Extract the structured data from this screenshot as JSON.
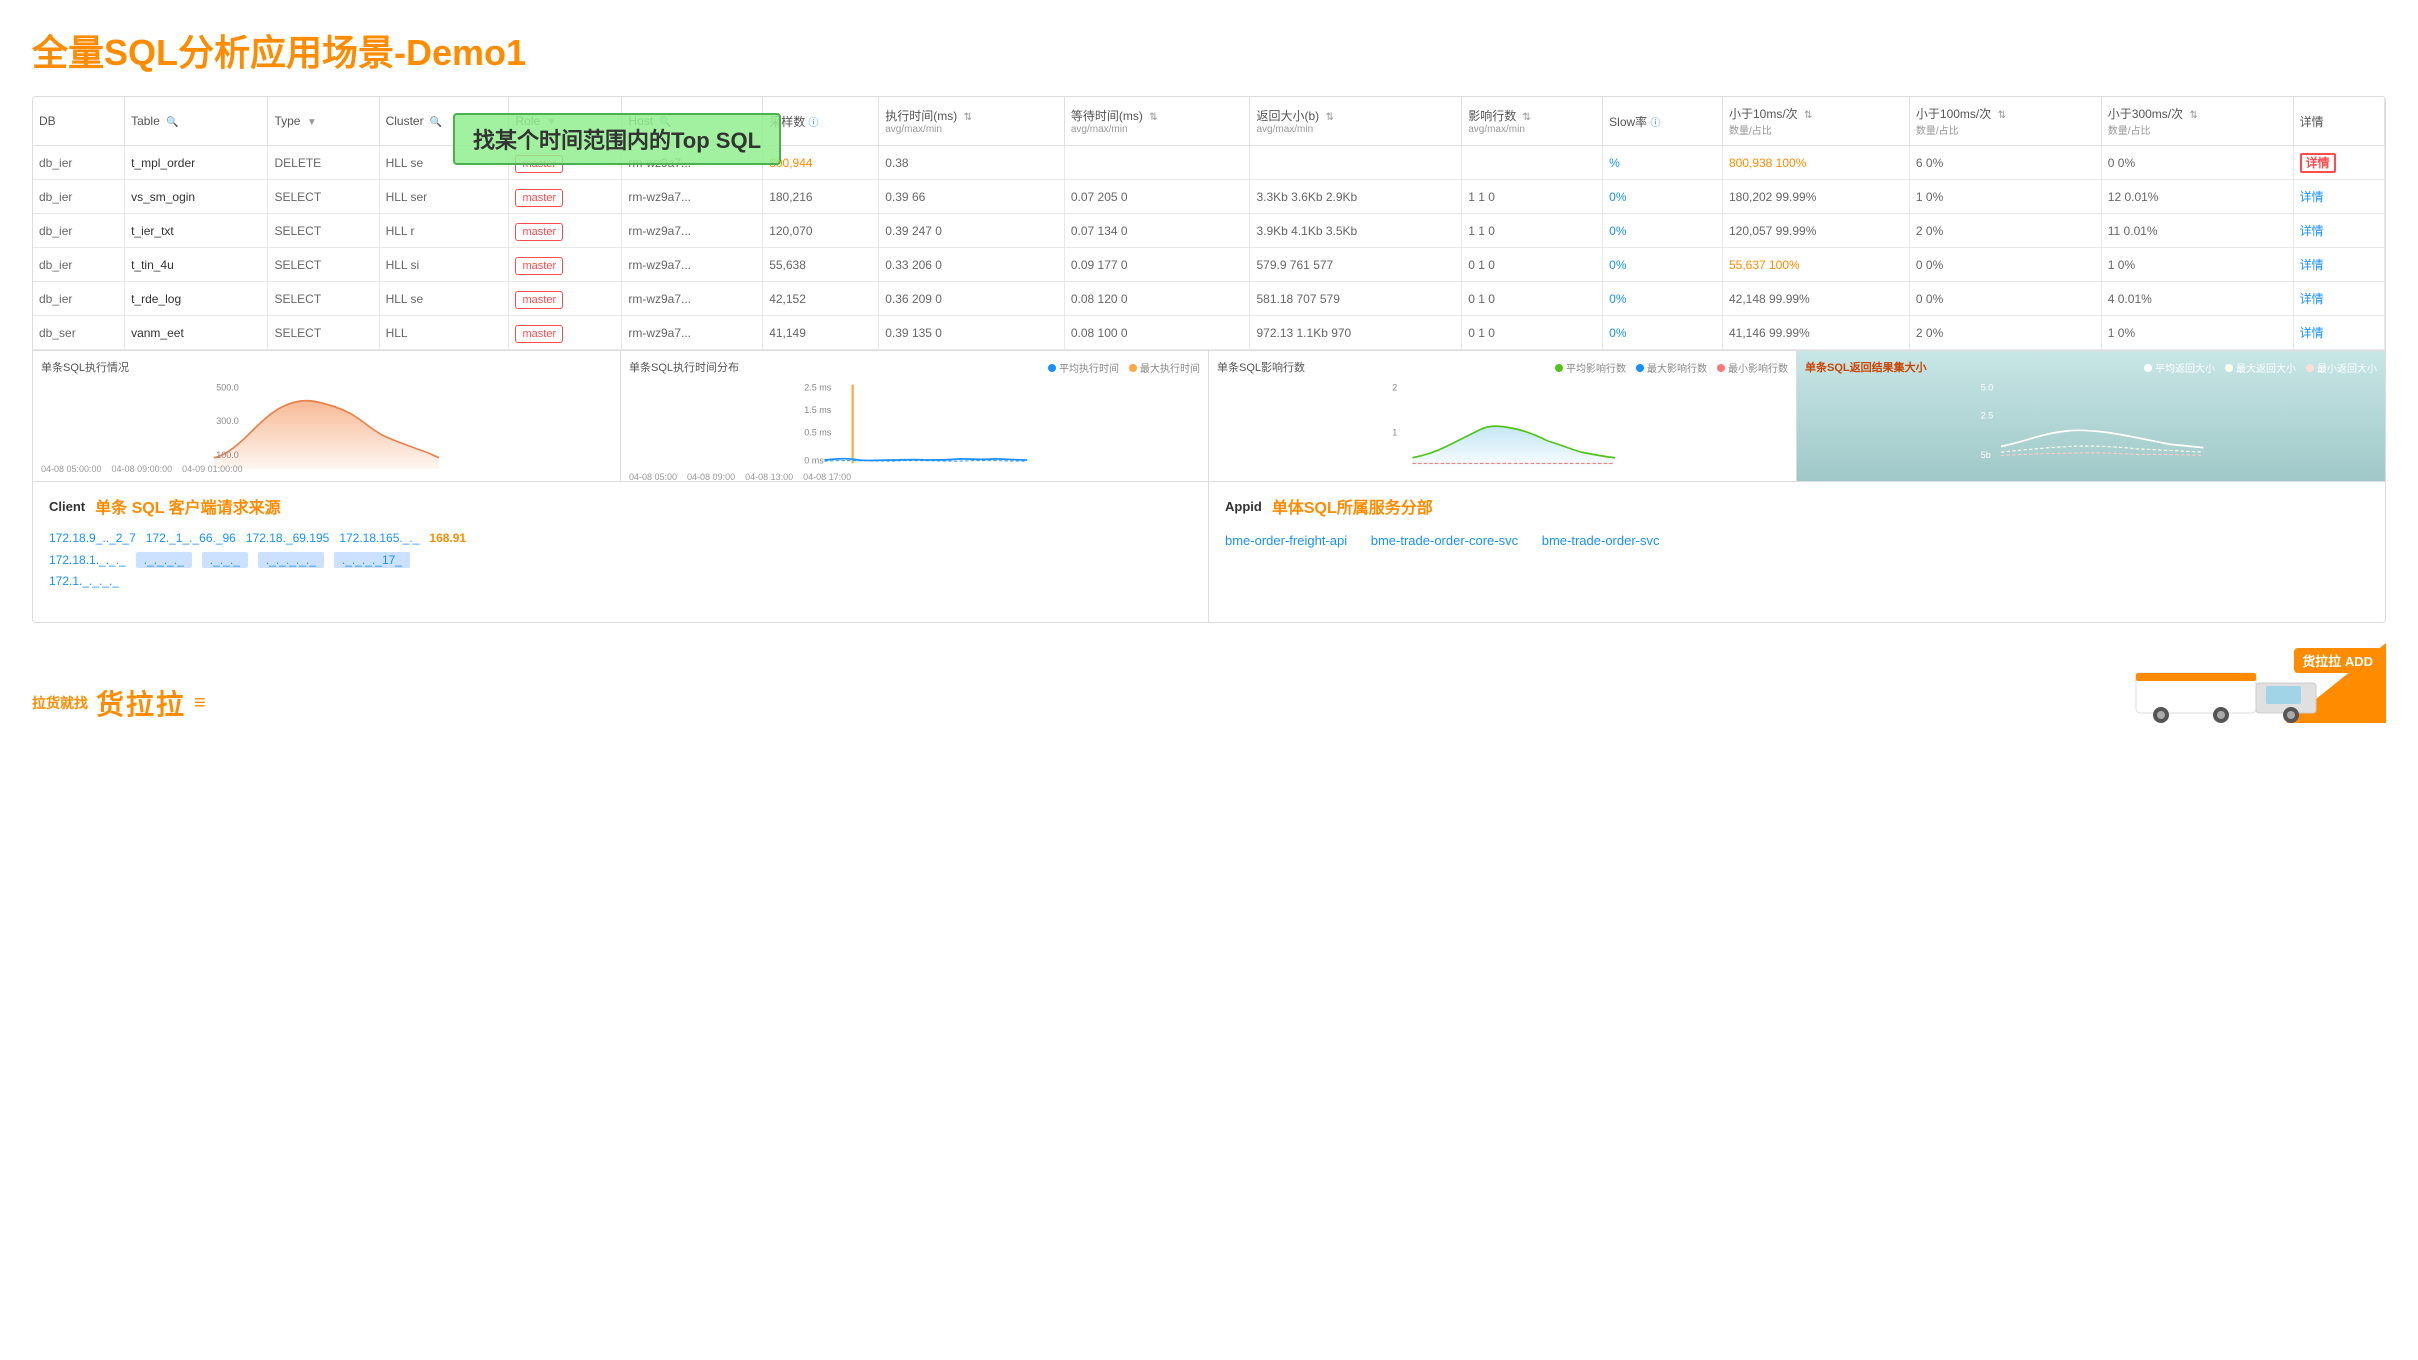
{
  "title": "全量SQL分析应用场景-Demo1",
  "table": {
    "columns": [
      {
        "label": "DB",
        "sub": ""
      },
      {
        "label": "Table",
        "sub": ""
      },
      {
        "label": "Type",
        "sub": ""
      },
      {
        "label": "Cluster",
        "sub": ""
      },
      {
        "label": "Role",
        "sub": ""
      },
      {
        "label": "Host",
        "sub": ""
      },
      {
        "label": "采样数",
        "sub": ""
      },
      {
        "label": "执行时间(ms)",
        "sub": "avg/max/min"
      },
      {
        "label": "等待时间(ms)",
        "sub": "avg/max/min"
      },
      {
        "label": "返回大小(b)",
        "sub": "avg/max/min"
      },
      {
        "label": "影响行数",
        "sub": "avg/max/min"
      },
      {
        "label": "Slow率",
        "sub": ""
      },
      {
        "label": "小于10ms/次",
        "sub": "数量/占比"
      },
      {
        "label": "小于100ms/次",
        "sub": "数量/占比"
      },
      {
        "label": "小于300ms/次",
        "sub": "数量/占比"
      },
      {
        "label": "详情",
        "sub": ""
      }
    ],
    "rows": [
      {
        "db": "db_ier",
        "table": "t_mpl_order",
        "type": "DELETE",
        "cluster": "HLL se",
        "role": "master",
        "host": "rm-wz9a7...",
        "samples": "800,944",
        "exec_time": "0.38",
        "wait_time": "",
        "return_size": "",
        "affect_rows": "",
        "slow_rate": "%",
        "lt10ms": "800,938 100%",
        "lt100ms": "6 0%",
        "lt300ms": "0 0%",
        "detail": "详情",
        "detail_highlighted": true
      },
      {
        "db": "db_ier",
        "table": "vs_sm_ogin",
        "type": "SELECT",
        "cluster": "HLL ser",
        "role": "master",
        "host": "rm-wz9a7...",
        "samples": "180,216",
        "exec_time": "0.39 66",
        "wait_time": "0.07 205 0",
        "return_size": "3.3Kb 3.6Kb 2.9Kb",
        "affect_rows": "1 1 0",
        "slow_rate": "0%",
        "lt10ms": "180,202 99.99%",
        "lt100ms": "1 0%",
        "lt300ms": "12 0.01%",
        "detail": "详情",
        "detail_highlighted": false
      },
      {
        "db": "db_ier",
        "table": "t_ier_txt",
        "type": "SELECT",
        "cluster": "HLL r",
        "role": "master",
        "host": "rm-wz9a7...",
        "samples": "120,070",
        "exec_time": "0.39 247 0",
        "wait_time": "0.07 134 0",
        "return_size": "3.9Kb 4.1Kb 3.5Kb",
        "affect_rows": "1 1 0",
        "slow_rate": "0%",
        "lt10ms": "120,057 99.99%",
        "lt100ms": "2 0%",
        "lt300ms": "11 0.01%",
        "detail": "详情",
        "detail_highlighted": false
      },
      {
        "db": "db_ier",
        "table": "t_tin_4u",
        "type": "SELECT",
        "cluster": "HLL si",
        "role": "master",
        "host": "rm-wz9a7...",
        "samples": "55,638",
        "exec_time": "0.33 206 0",
        "wait_time": "0.09 177 0",
        "return_size": "579.9 761 577",
        "affect_rows": "0 1 0",
        "slow_rate": "0%",
        "lt10ms": "55,637 100%",
        "lt100ms": "0 0%",
        "lt300ms": "1 0%",
        "detail": "详情",
        "detail_highlighted": false
      },
      {
        "db": "db_ier",
        "table": "t_rde_log",
        "type": "SELECT",
        "cluster": "HLL se",
        "role": "master",
        "host": "rm-wz9a7...",
        "samples": "42,152",
        "exec_time": "0.36 209 0",
        "wait_time": "0.08 120 0",
        "return_size": "581.18 707 579",
        "affect_rows": "0 1 0",
        "slow_rate": "0%",
        "lt10ms": "42,148 99.99%",
        "lt100ms": "0 0%",
        "lt300ms": "4 0.01%",
        "detail": "详情",
        "detail_highlighted": false
      },
      {
        "db": "db_ser",
        "table": "vanm_eet",
        "type": "SELECT",
        "cluster": "HLL",
        "role": "master",
        "host": "rm-wz9a7...",
        "samples": "41,149",
        "exec_time": "0.39 135 0",
        "wait_time": "0.08 100 0",
        "return_size": "972.13 1.1Kb 970",
        "affect_rows": "0 1 0",
        "slow_rate": "0%",
        "lt10ms": "41,146 99.99%",
        "lt100ms": "2 0%",
        "lt300ms": "1 0%",
        "detail": "详情",
        "detail_highlighted": false
      }
    ]
  },
  "annotation": {
    "text": "找某个时间范围内的Top SQL"
  },
  "charts": [
    {
      "title": "单条SQL执行情况",
      "type": "area",
      "color": "#f5a87a"
    },
    {
      "title": "单条SQL执行时间分布",
      "type": "line",
      "color": "#1890ff",
      "legend": [
        "平均执行时间",
        "最大执行时间"
      ]
    },
    {
      "title": "单条SQL影响行数",
      "type": "area",
      "color": "#87ceeb",
      "legend": [
        "平均影响行数",
        "最大影响行数",
        "最小影响行数"
      ]
    },
    {
      "title": "单条SQL返回结果集大小",
      "type": "area",
      "color": "#82c0c0",
      "legend": [
        "平均返回大小",
        "最大返回大小",
        "最小返回大小"
      ]
    }
  ],
  "client_section": {
    "label": "Client",
    "title": "单条 SQL 客户端请求来源",
    "ips": [
      "172.18.9_.._2_7",
      "172._1_._66._96",
      "172.18._69.195",
      "172.18.165._._",
      "168.91",
      "172.18.1._._._",
      "._._._._",
      "._._._",
      "._._._._._",
      "._._._._17_",
      "172.1._._._._"
    ]
  },
  "appid_section": {
    "label": "Appid",
    "title": "单体SQL所属服务分部",
    "services": [
      "bme-order-freight-api",
      "bme-trade-order-core-svc",
      "bme-trade-order-svc"
    ]
  },
  "footer": {
    "logo": "拉货就找货拉拉"
  }
}
